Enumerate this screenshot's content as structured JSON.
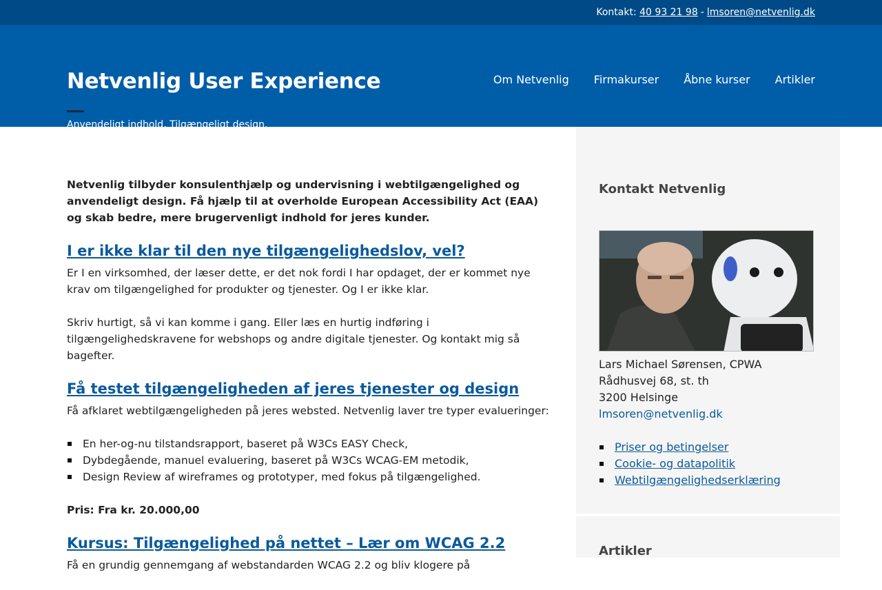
{
  "topbar": {
    "contact_label": "Kontakt:",
    "phone": "40 93 21 98",
    "separator": "-",
    "email": "lmsoren@netvenlig.dk"
  },
  "header": {
    "title": "Netvenlig User Experience",
    "tagline": "Anvendeligt indhold, Tilgængeligt design.",
    "nav": [
      "Om Netvenlig",
      "Firmakurser",
      "Åbne kurser",
      "Artikler"
    ]
  },
  "main": {
    "intro": "Netvenlig tilbyder konsulenthjælp og undervisning i webtilgængelighed og anvendeligt design. Få hjælp til at overholde European Accessibility Act (EAA) og skab bedre, mere brugervenligt indhold for jeres kunder.",
    "section1": {
      "heading": "I er ikke klar til den nye tilgængelighedslov, vel?",
      "p1": "Er I en virksomhed, der læser dette, er det nok fordi I har opdaget, der er kommet nye krav om tilgængelighed for produkter og tjenester. Og I er ikke klar.",
      "p2": "Skriv hurtigt, så vi kan komme i gang. Eller læs en hurtig indføring i tilgængelighedskravene for webshops og andre digitale tjenester. Og kontakt mig så bagefter."
    },
    "section2": {
      "heading": "Få testet tilgængeligheden af jeres tjenester og design",
      "p1": "Få afklaret webtilgængeligheden på jeres websted. Netvenlig laver tre typer evalueringer:",
      "items": [
        "En her-og-nu tilstandsrapport, baseret på W3Cs EASY Check,",
        "Dybdegående, manuel evaluering, baseret på W3Cs WCAG-EM metodik,",
        "Design Review af wireframes og prototyper, med fokus på tilgængelighed."
      ],
      "price": "Pris: Fra kr. 20.000,00"
    },
    "section3": {
      "heading": "Kursus: Tilgængelighed på nettet – Lær om WCAG 2.2",
      "p1": "Få en grundig gennemgang af webstandarden WCAG 2.2 og bliv klogere på"
    }
  },
  "sidebar": {
    "heading": "Kontakt Netvenlig",
    "name": "Lars Michael Sørensen, CPWA",
    "address1": "Rådhusvej 68, st. th",
    "address2": "3200 Helsinge",
    "email": "lmsoren@netvenlig.dk",
    "links": [
      "Priser og betingelser",
      "Cookie- og datapolitik",
      "Webtilgængelighedserklæring"
    ],
    "heading2": "Artikler"
  }
}
